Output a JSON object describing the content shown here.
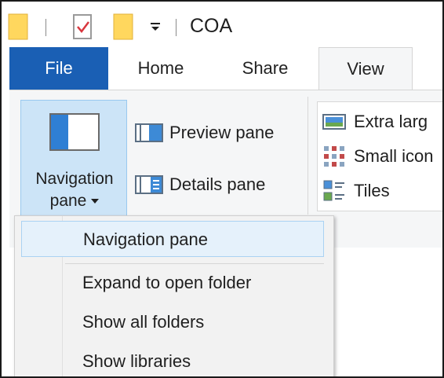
{
  "window": {
    "title": "COA"
  },
  "tabs": {
    "file": "File",
    "home": "Home",
    "share": "Share",
    "view": "View"
  },
  "ribbon": {
    "navigation_pane": {
      "line1": "Navigation",
      "line2": "pane"
    },
    "preview_pane": "Preview pane",
    "details_pane": "Details pane",
    "layout": {
      "extra_large": "Extra larg",
      "small_icons": "Small icon",
      "tiles": "Tiles"
    }
  },
  "dropdown": {
    "items": [
      {
        "label": "Navigation pane",
        "selected": true
      },
      {
        "label": "Expand to open folder"
      },
      {
        "label": "Show all folders"
      },
      {
        "label": "Show libraries"
      }
    ]
  },
  "colors": {
    "file_tab": "#1a5fb4",
    "nav_button_bg": "#cce4f7",
    "selected_item_bg": "#e5f1fb",
    "folder_icon": "#ffd75e"
  }
}
